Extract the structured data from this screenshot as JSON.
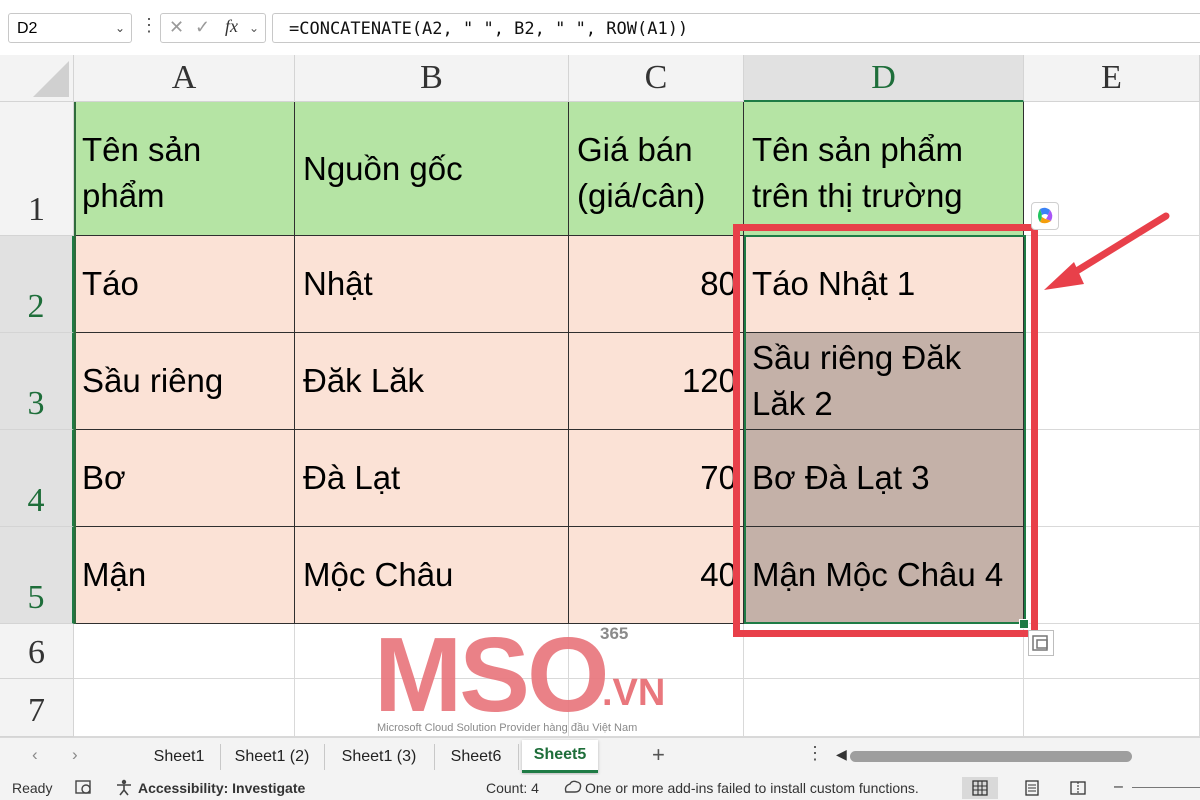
{
  "formula_bar": {
    "name_box": "D2",
    "formula": "=CONCATENATE(A2, \" \", B2, \" \", ROW(A1))"
  },
  "columns": [
    "A",
    "B",
    "C",
    "D",
    "E"
  ],
  "rows": [
    "1",
    "2",
    "3",
    "4",
    "5",
    "6",
    "7"
  ],
  "header_row": [
    "Tên sản phẩm",
    "Nguồn gốc",
    "Giá bán (giá/cân)",
    "Tên sản phẩm trên thị trường"
  ],
  "data_rows": [
    [
      "Táo",
      "Nhật",
      "80",
      "Táo Nhật 1"
    ],
    [
      "Sầu riêng",
      "Đăk Lăk",
      "120",
      "Sầu riêng Đăk Lăk 2"
    ],
    [
      "Bơ",
      "Đà Lạt",
      "70",
      "Bơ Đà Lạt 3"
    ],
    [
      "Mận",
      "Mộc Châu",
      "40",
      "Mận Mộc Châu 4"
    ]
  ],
  "watermark": {
    "logo": "MSO",
    "superscript": "365",
    "suffix": ".VN",
    "tagline": "Microsoft Cloud Solution Provider hàng đầu Việt Nam"
  },
  "sheet_tabs": [
    "Sheet1",
    "Sheet1 (2)",
    "Sheet1 (3)",
    "Sheet6",
    "Sheet5"
  ],
  "active_sheet": "Sheet5",
  "status_bar": {
    "ready": "Ready",
    "accessibility": "Accessibility: Investigate",
    "count": "Count: 4",
    "addin_message": "One or more add-ins failed to install custom functions."
  },
  "colors": {
    "header_fill": "#b5e4a4",
    "data_fill": "#fbe2d6",
    "result_fill": "#c4b1a8",
    "highlight": "#e8404a",
    "selection": "#1e7b45"
  }
}
